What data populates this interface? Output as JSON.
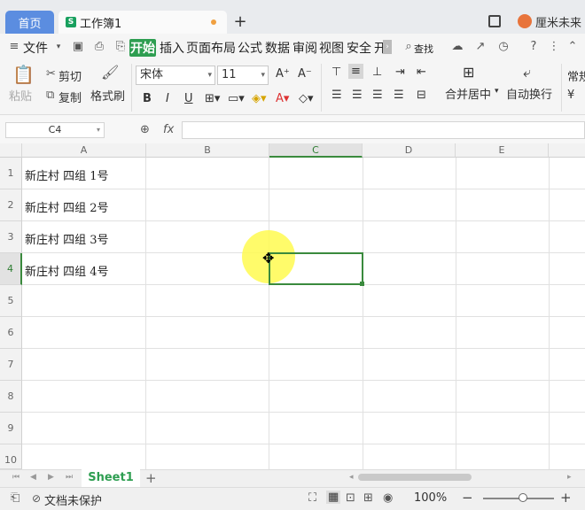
{
  "titlebar": {
    "home_tab": "首页",
    "doc_tab": "工作簿1",
    "doc_icon": "S",
    "new_tab": "+",
    "user": "厘米未来"
  },
  "menu": {
    "file": "文件",
    "items": [
      "开始",
      "插入",
      "页面布局",
      "公式",
      "数据",
      "审阅",
      "视图",
      "安全",
      "开"
    ],
    "search": "查找"
  },
  "ribbon": {
    "paste": "粘贴",
    "cut": "剪切",
    "copy": "复制",
    "format_painter": "格式刷",
    "font_name": "宋体",
    "font_size": "11",
    "grow_font": "A⁺",
    "shrink_font": "A⁻",
    "bold": "B",
    "italic": "I",
    "underline": "U",
    "merge_center": "合并居中",
    "wrap_text": "自动换行",
    "normal": "常规"
  },
  "formula_bar": {
    "name_box": "C4",
    "fx": "fx",
    "formula": ""
  },
  "grid": {
    "columns": [
      "A",
      "B",
      "C",
      "D",
      "E"
    ],
    "selected_column": "C",
    "rows": [
      "1",
      "2",
      "3",
      "4",
      "5",
      "6",
      "7",
      "8",
      "9",
      "10"
    ],
    "selected_row": "4",
    "cells_a": [
      "新庄村 四组 1号",
      "新庄村 四组 2号",
      "新庄村 四组 3号",
      "新庄村 四组 4号"
    ]
  },
  "sheets": {
    "active": "Sheet1",
    "add": "+"
  },
  "status": {
    "protect": "文档未保护",
    "zoom": "100%"
  }
}
